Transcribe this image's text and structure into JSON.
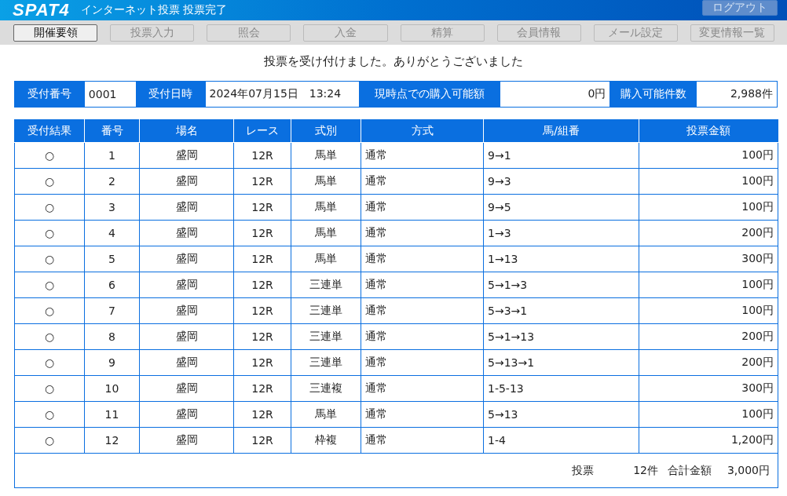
{
  "header": {
    "logo": "SPAT4",
    "title": "インターネット投票 投票完了",
    "logout": {
      "label": "ログアウト",
      "disabled": true
    }
  },
  "nav": [
    {
      "label": "開催要領",
      "disabled": false
    },
    {
      "label": "投票入力",
      "disabled": true
    },
    {
      "label": "照会",
      "disabled": true
    },
    {
      "label": "入金",
      "disabled": true
    },
    {
      "label": "精算",
      "disabled": true
    },
    {
      "label": "会員情報",
      "disabled": true
    },
    {
      "label": "メール設定",
      "disabled": true
    },
    {
      "label": "変更情報一覧",
      "disabled": true
    }
  ],
  "message": "投票を受け付けました。ありがとうございました",
  "info": [
    {
      "label": "受付番号",
      "value": "0001"
    },
    {
      "label": "受付日時",
      "value": "2024年07月15日　13:24"
    },
    {
      "label": "現時点での購入可能額",
      "value": "0円"
    },
    {
      "label": "購入可能件数",
      "value": "2,988件"
    }
  ],
  "table": {
    "columns": [
      "受付結果",
      "番号",
      "場名",
      "レース",
      "式別",
      "方式",
      "馬/組番",
      "投票金額"
    ],
    "rows": [
      [
        "○",
        "1",
        "盛岡",
        "12R",
        "馬単",
        "通常",
        "9→1",
        "100円"
      ],
      [
        "○",
        "2",
        "盛岡",
        "12R",
        "馬単",
        "通常",
        "9→3",
        "100円"
      ],
      [
        "○",
        "3",
        "盛岡",
        "12R",
        "馬単",
        "通常",
        "9→5",
        "100円"
      ],
      [
        "○",
        "4",
        "盛岡",
        "12R",
        "馬単",
        "通常",
        "1→3",
        "200円"
      ],
      [
        "○",
        "5",
        "盛岡",
        "12R",
        "馬単",
        "通常",
        "1→13",
        "300円"
      ],
      [
        "○",
        "6",
        "盛岡",
        "12R",
        "三連単",
        "通常",
        "5→1→3",
        "100円"
      ],
      [
        "○",
        "7",
        "盛岡",
        "12R",
        "三連単",
        "通常",
        "5→3→1",
        "100円"
      ],
      [
        "○",
        "8",
        "盛岡",
        "12R",
        "三連単",
        "通常",
        "5→1→13",
        "200円"
      ],
      [
        "○",
        "9",
        "盛岡",
        "12R",
        "三連単",
        "通常",
        "5→13→1",
        "200円"
      ],
      [
        "○",
        "10",
        "盛岡",
        "12R",
        "三連複",
        "通常",
        "1-5-13",
        "300円"
      ],
      [
        "○",
        "11",
        "盛岡",
        "12R",
        "馬単",
        "通常",
        "5→13",
        "100円"
      ],
      [
        "○",
        "12",
        "盛岡",
        "12R",
        "枠複",
        "通常",
        "1-4",
        "1,200円"
      ]
    ],
    "summary": {
      "votes_label": "投票",
      "votes_count": "12件",
      "total_label": "合計金額",
      "total_value": "3,000円"
    }
  }
}
